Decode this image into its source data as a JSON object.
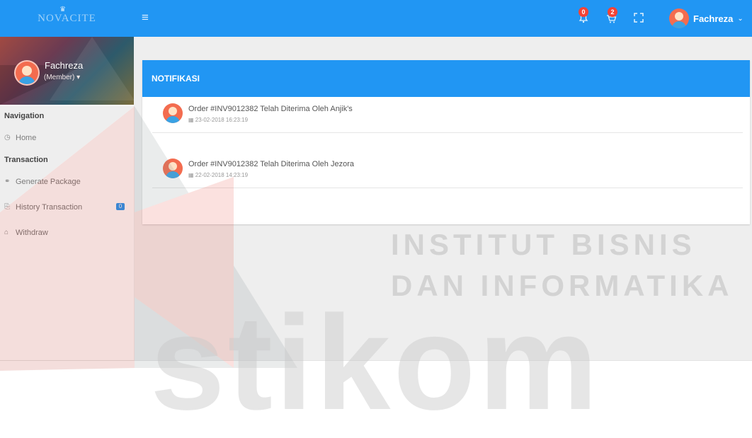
{
  "brand": {
    "logo_text": "NOVACITE",
    "crown": "♛"
  },
  "header": {
    "menu_icon": "hamburger-menu-icon",
    "notification_count": "0",
    "cart_count": "2",
    "fullscreen_icon": "expand-icon",
    "user_name": "Fachreza"
  },
  "sidebar": {
    "profile_name": "Fachreza",
    "profile_role": "(Member) ▾",
    "sections": [
      {
        "header": "Navigation"
      },
      {
        "header": "Transaction"
      }
    ],
    "items": [
      {
        "label": "Home",
        "icon": "dashboard-icon"
      },
      {
        "label": "Generate Package",
        "icon": "share-icon"
      },
      {
        "label": "History Transaction",
        "icon": "copy-icon",
        "badge": "0"
      },
      {
        "label": "Withdraw",
        "icon": "bank-icon"
      }
    ]
  },
  "panel": {
    "title": "NOTIFIKASI",
    "notifications": [
      {
        "text": "Order #INV9012382 Telah Diterima Oleh Anjik's",
        "date": "23-02-2018 16:23:19"
      },
      {
        "text": "Order #INV9012382 Telah Diterima Oleh Jezora",
        "date": "22-02-2018 14:23:19"
      }
    ]
  },
  "watermark": {
    "line1": "INSTITUT BISNIS",
    "line2": "DAN INFORMATIKA",
    "big": "stikom"
  },
  "colors": {
    "primary": "#2196f3",
    "badge": "#f44336",
    "content_bg": "#eeeeee"
  }
}
